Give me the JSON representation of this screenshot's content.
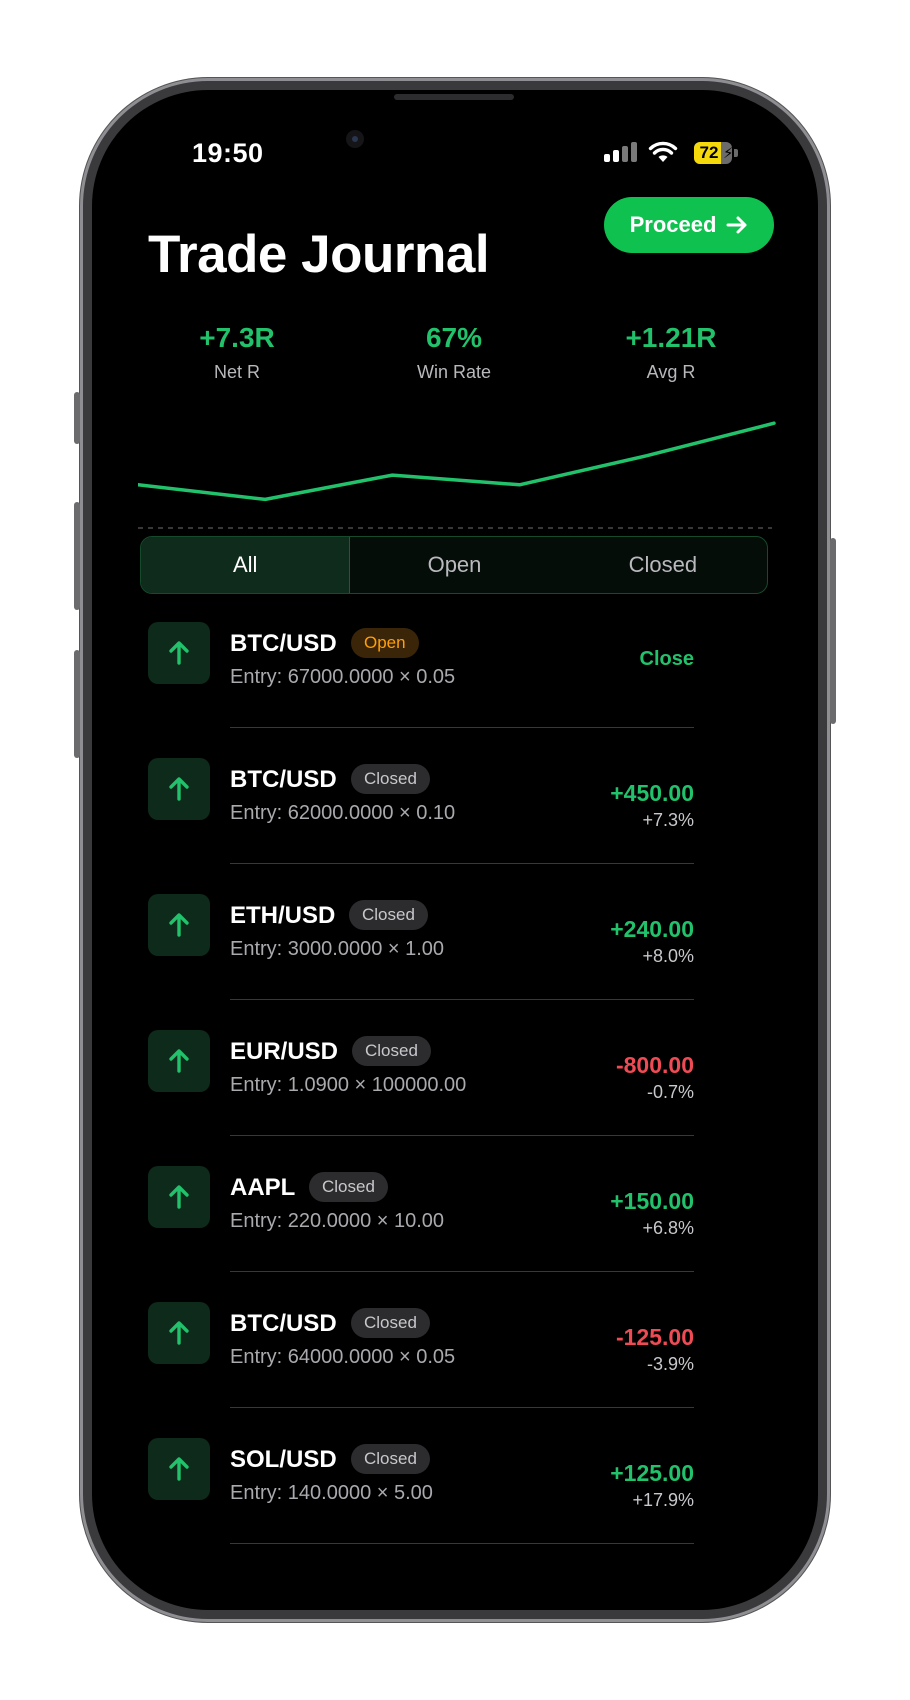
{
  "status_bar": {
    "time": "19:50",
    "battery_percent": "72",
    "battery_level": 0.72
  },
  "header": {
    "title": "Trade Journal",
    "proceed_label": "Proceed"
  },
  "stats": [
    {
      "value": "+7.3R",
      "label": "Net R"
    },
    {
      "value": "67%",
      "label": "Win Rate"
    },
    {
      "value": "+1.21R",
      "label": "Avg R"
    }
  ],
  "chart_data": {
    "type": "line",
    "series": [
      {
        "values": [
          0,
          -0.9,
          0.6,
          0,
          1.8,
          3.8
        ]
      }
    ],
    "grid": false,
    "colors": {
      "line": "#22c16b"
    }
  },
  "tabs": [
    {
      "label": "All",
      "active": true
    },
    {
      "label": "Open",
      "active": false
    },
    {
      "label": "Closed",
      "active": false
    }
  ],
  "trades": [
    {
      "symbol": "BTC/USD",
      "status": "Open",
      "entry": "Entry: 67000.0000 × 0.05",
      "action": "Close"
    },
    {
      "symbol": "BTC/USD",
      "status": "Closed",
      "entry": "Entry: 62000.0000 × 0.10",
      "pnl": "+450.00",
      "pct": "+7.3%"
    },
    {
      "symbol": "ETH/USD",
      "status": "Closed",
      "entry": "Entry: 3000.0000 × 1.00",
      "pnl": "+240.00",
      "pct": "+8.0%"
    },
    {
      "symbol": "EUR/USD",
      "status": "Closed",
      "entry": "Entry: 1.0900 × 100000.00",
      "pnl": "-800.00",
      "pct": "-0.7%"
    },
    {
      "symbol": "AAPL",
      "status": "Closed",
      "entry": "Entry: 220.0000 × 10.00",
      "pnl": "+150.00",
      "pct": "+6.8%"
    },
    {
      "symbol": "BTC/USD",
      "status": "Closed",
      "entry": "Entry: 64000.0000 × 0.05",
      "pnl": "-125.00",
      "pct": "-3.9%"
    },
    {
      "symbol": "SOL/USD",
      "status": "Closed",
      "entry": "Entry: 140.0000 × 5.00",
      "pnl": "+125.00",
      "pct": "+17.9%"
    }
  ],
  "icons": {
    "direction": "arrow-up-icon",
    "proceed": "arrow-right-icon"
  },
  "colors": {
    "accent": "#0fc14f",
    "profit": "#22c16b",
    "loss": "#ef4b55",
    "open_badge": "#ff9f0a"
  }
}
